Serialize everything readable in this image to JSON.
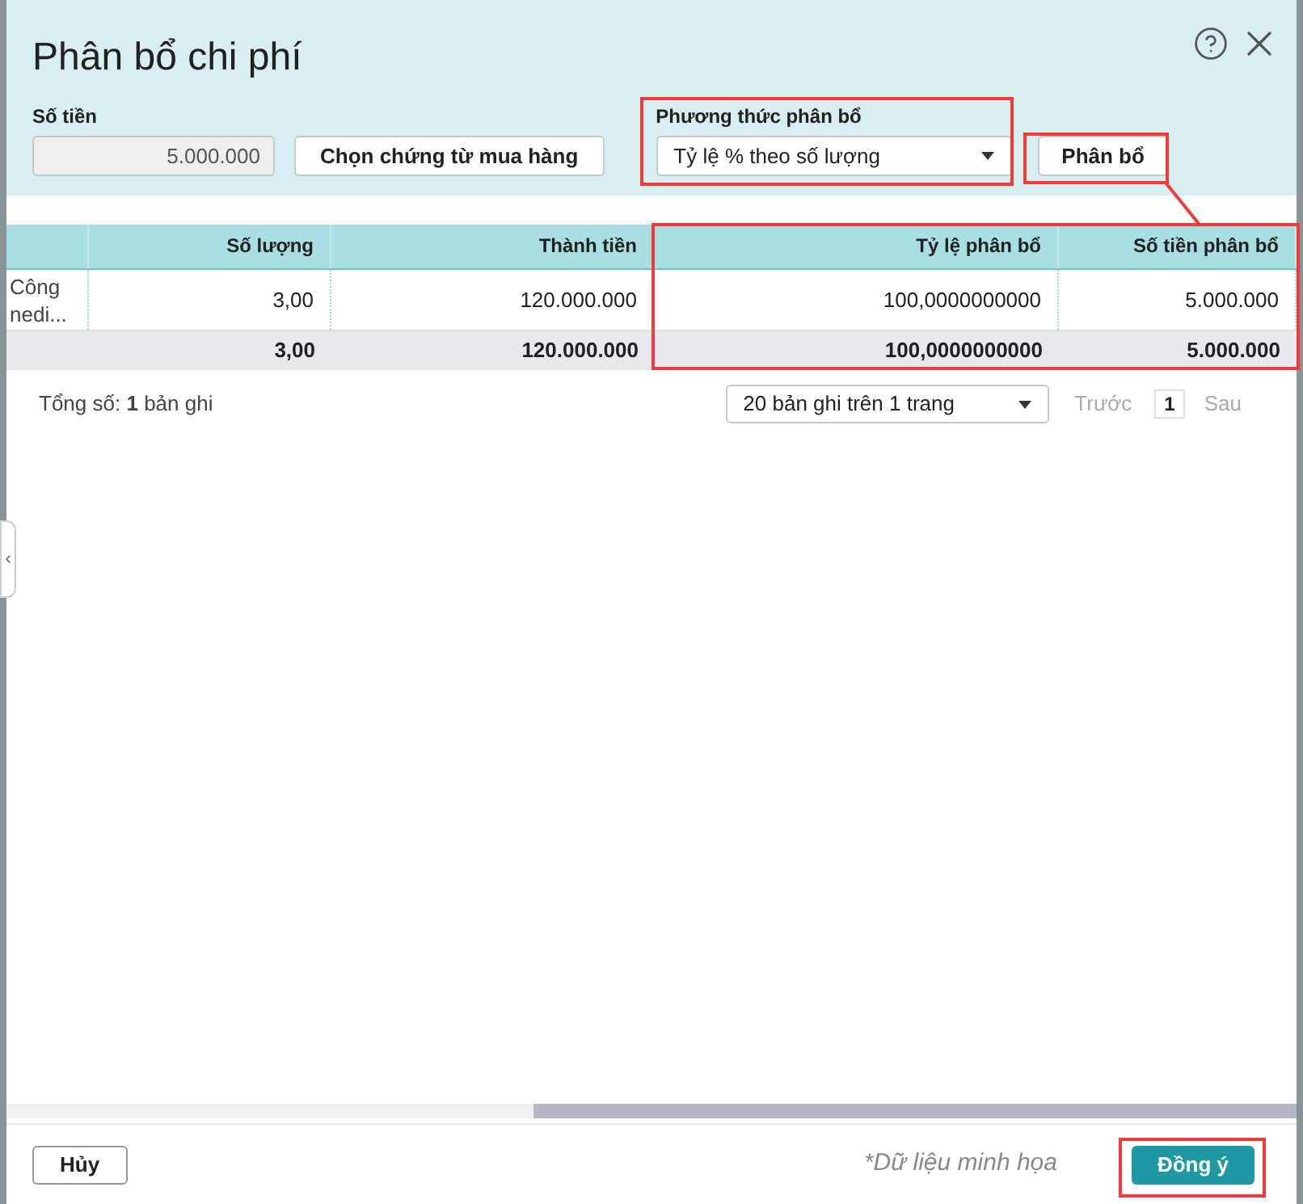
{
  "dialog": {
    "title": "Phân bổ chi phí"
  },
  "amount": {
    "label": "Số tiền",
    "value": "5.000.000"
  },
  "choose_button": "Chọn chứng từ mua hàng",
  "method": {
    "label": "Phương thức phân bổ",
    "value": "Tỷ lệ % theo số lượng"
  },
  "allocate_button": "Phân bổ",
  "table": {
    "columns": [
      "",
      "Số lượng",
      "Thành tiền",
      "Tỷ lệ phân bổ",
      "Số tiền phân bổ"
    ],
    "rows": [
      [
        "Công nedi...",
        "3,00",
        "120.000.000",
        "100,0000000000",
        "5.000.000"
      ]
    ],
    "totals": [
      "3,00",
      "120.000.000",
      "100,0000000000",
      "5.000.000"
    ]
  },
  "pagination": {
    "total_label": "Tổng số:",
    "total_count": "1",
    "total_unit": "bản ghi",
    "page_size": "20 bản ghi trên 1 trang",
    "prev": "Trước",
    "page": "1",
    "next": "Sau"
  },
  "footer": {
    "cancel": "Hủy",
    "note": "*Dữ liệu minh họa",
    "ok": "Đồng ý"
  }
}
